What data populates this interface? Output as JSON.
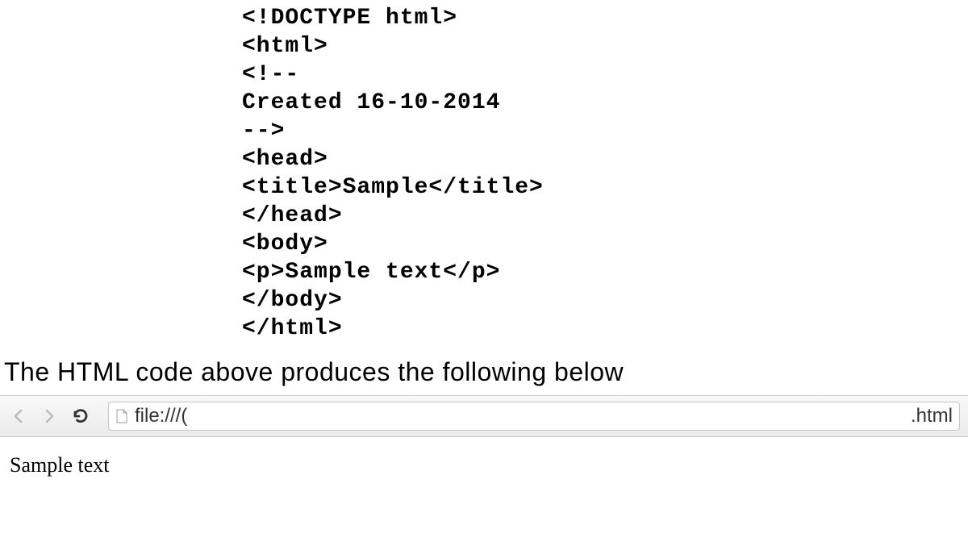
{
  "code": {
    "line1": "<!DOCTYPE html>",
    "line2": "<html>",
    "line3": "<!--",
    "line4": "Created 16-10-2014",
    "line5": "-->",
    "line6": "<head>",
    "line7": "<title>Sample</title>",
    "line8": "</head>",
    "line9": "<body>",
    "line10": "<p>Sample text</p>",
    "line11": "</body>",
    "line12": "</html>"
  },
  "caption": "The HTML code above produces the following below",
  "browser": {
    "url_prefix": "file:///(",
    "url_ext": ".html",
    "page_text": "Sample text"
  }
}
